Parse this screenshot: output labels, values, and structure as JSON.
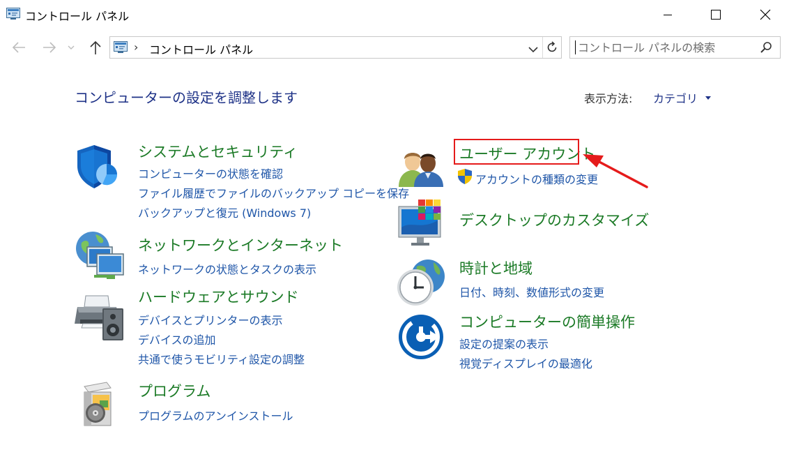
{
  "window": {
    "title": "コントロール パネル",
    "minimize_icon": "minimize-icon",
    "maximize_icon": "maximize-icon",
    "close_icon": "close-icon"
  },
  "nav": {
    "back_icon": "back-arrow-icon",
    "forward_icon": "forward-arrow-icon",
    "recent_icon": "chevron-down-icon",
    "up_icon": "up-arrow-icon"
  },
  "address": {
    "path": "コントロール パネル",
    "separator": "›",
    "refresh_icon": "refresh-icon"
  },
  "search": {
    "placeholder": "コントロール パネルの検索",
    "value": ""
  },
  "main": {
    "title": "コンピューターの設定を調整します",
    "view_by_label": "表示方法:",
    "view_by_value": "カテゴリ"
  },
  "categories": [
    {
      "name": "システムとセキュリティ",
      "icon": "security-shield-icon",
      "links": [
        "コンピューターの状態を確認",
        "ファイル履歴でファイルのバックアップ コピーを保存",
        "バックアップと復元 (Windows 7)"
      ]
    },
    {
      "name": "ネットワークとインターネット",
      "icon": "network-globe-icon",
      "links": [
        "ネットワークの状態とタスクの表示"
      ]
    },
    {
      "name": "ハードウェアとサウンド",
      "icon": "printer-speaker-icon",
      "links": [
        "デバイスとプリンターの表示",
        "デバイスの追加",
        "共通で使うモビリティ設定の調整"
      ]
    },
    {
      "name": "プログラム",
      "icon": "programs-disc-icon",
      "links": [
        "プログラムのアンインストール"
      ]
    },
    {
      "name": "ユーザー アカウント",
      "icon": "users-icon",
      "links": [
        "アカウントの種類の変更"
      ],
      "link_icon": "uac-shield-icon"
    },
    {
      "name": "デスクトップのカスタマイズ",
      "icon": "desktop-monitor-icon",
      "links": []
    },
    {
      "name": "時計と地域",
      "icon": "clock-globe-icon",
      "links": [
        "日付、時刻、数値形式の変更"
      ]
    },
    {
      "name": "コンピューターの簡単操作",
      "icon": "ease-of-access-icon",
      "links": [
        "設定の提案の表示",
        "視覚ディスプレイの最適化"
      ]
    }
  ],
  "annotation": {
    "highlight_color": "#e51b1b"
  },
  "colors": {
    "category_title": "#1b7a26",
    "link": "#1f56a8",
    "heading": "#1e3287"
  }
}
